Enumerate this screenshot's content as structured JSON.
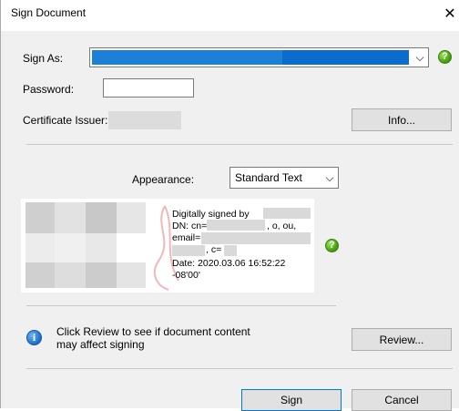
{
  "window": {
    "title": "Sign Document",
    "close_glyph": "✕"
  },
  "sign_as": {
    "label": "Sign As:",
    "selected_value": "",
    "arrow": "⌵"
  },
  "password": {
    "label": "Password:",
    "value": ""
  },
  "certificate_issuer": {
    "label": "Certificate Issuer:",
    "value": ""
  },
  "buttons": {
    "info": "Info...",
    "review": "Review...",
    "sign": "Sign",
    "cancel": "Cancel"
  },
  "appearance": {
    "label": "Appearance:",
    "selected": "Standard Text",
    "arrow": "⌵"
  },
  "preview": {
    "line1": "Digitally signed by",
    "line2_prefix": "DN: cn=",
    "line2_suffix": ", o, ou,",
    "line3": "email=",
    "line4": ", c=",
    "line5": "Date: 2020.03.06 16:52:22",
    "line6": "-08'00'"
  },
  "review_note": {
    "line1": "Click Review to see if document content",
    "line2": "may affect signing"
  },
  "help_glyph": "?",
  "info_glyph": "i",
  "colors": {
    "selection_blue": "#1c7fd8",
    "help_green": "#4aa311",
    "info_blue": "#1a6fc7",
    "primary_border": "#0078d7"
  }
}
